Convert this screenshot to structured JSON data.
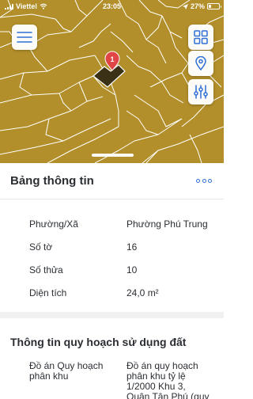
{
  "status_bar": {
    "carrier": "Viettel",
    "time": "23:05",
    "battery": "27%",
    "battery_level": 0.27
  },
  "map": {
    "marker_label": "1",
    "background_color": "#b28f2a",
    "line_color": "#ffffff",
    "parcel_color": "#3a3116",
    "marker_color": "#e04646"
  },
  "map_buttons": {
    "menu_icon": "hamburger-icon",
    "layers_icon": "grid-icon",
    "location_icon": "location-pin-icon",
    "filter_icon": "sliders-icon"
  },
  "info_panel": {
    "title": "Bảng thông tin",
    "more_icon": "more-dots-icon",
    "rows": [
      {
        "key": "Phường/Xã",
        "value": "Phường Phú Trung"
      },
      {
        "key": "Số tờ",
        "value": "16"
      },
      {
        "key": "Số thửa",
        "value": "10"
      },
      {
        "key": "Diện tích",
        "value": "24,0 m²"
      }
    ]
  },
  "planning": {
    "title": "Thông tin quy hoạch sử dụng đất",
    "key_line1": "Đồ án Quy hoạch",
    "key_line2": "phân khu",
    "value_lines": [
      "Đồ án quy hoạch",
      "phân khu tỷ lệ",
      "1/2000 Khu 3,",
      "Quận Tân Phú (quy"
    ]
  },
  "accent_color": "#2f6fd6"
}
